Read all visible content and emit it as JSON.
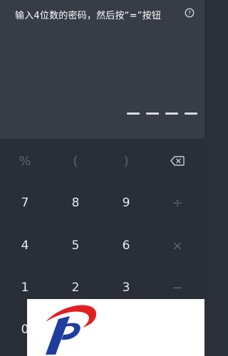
{
  "header": {
    "prompt": "输入4位数的密码，然后按“=”按钮",
    "help_icon": "question-circle-icon"
  },
  "pin": {
    "length": 4,
    "entered": 0
  },
  "keypad": {
    "row1": [
      "%",
      "(",
      ")",
      "⌫"
    ],
    "row2": [
      "7",
      "8",
      "9",
      "÷"
    ],
    "row3": [
      "4",
      "5",
      "6",
      "×"
    ],
    "row4": [
      "1",
      "2",
      "3",
      "−"
    ],
    "row5": [
      "0"
    ]
  },
  "colors": {
    "top_bg": "#373c47",
    "keypad_bg": "#2a2e37",
    "digit": "#e9ebef",
    "dim": "#5f6470",
    "logo_red": "#e02020",
    "logo_blue": "#1f3d9c"
  }
}
